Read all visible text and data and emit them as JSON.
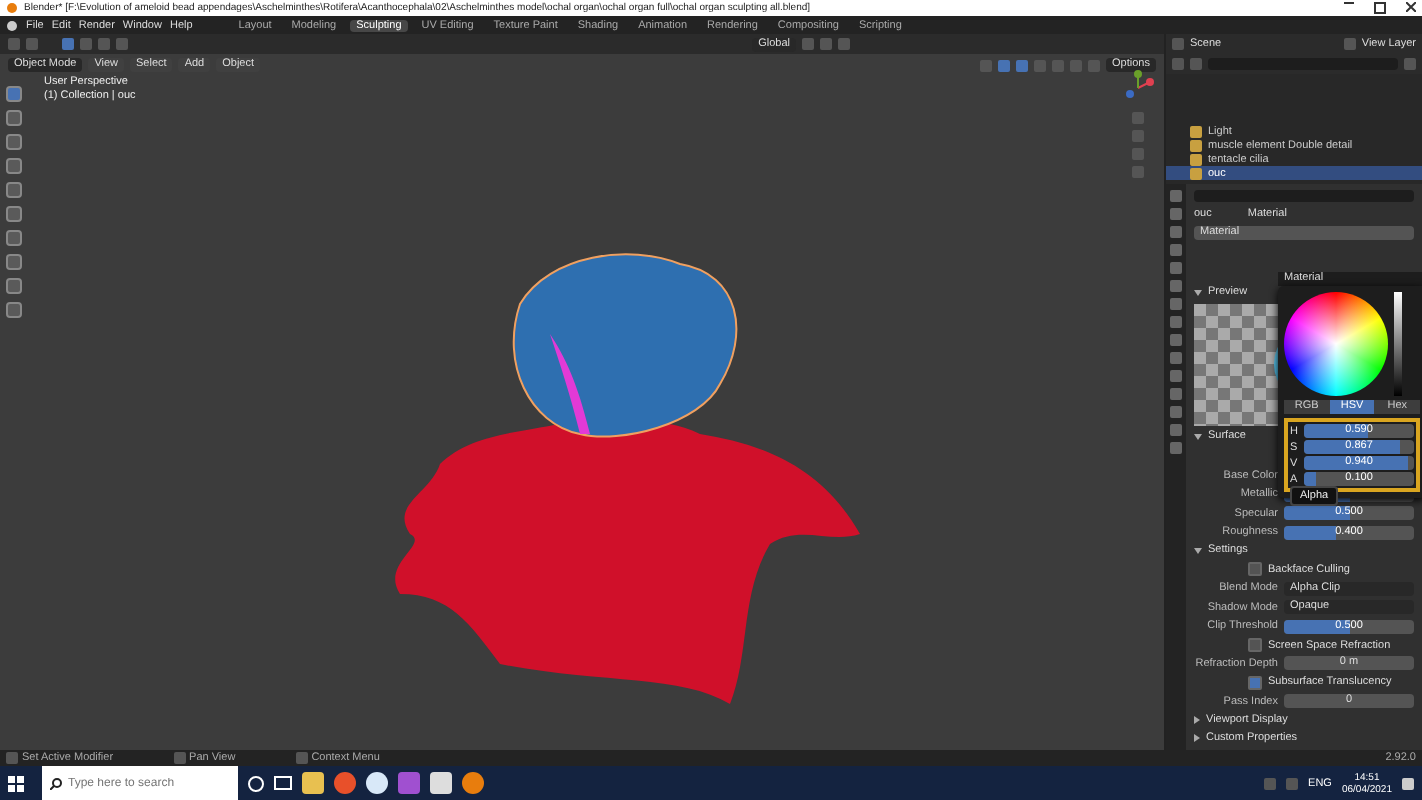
{
  "window": {
    "title": "Blender* [F:\\Evolution of ameloid bead appendages\\Aschelminthes\\Rotifera\\Acanthocephala\\02\\Aschelminthes model\\ochal organ\\ochal organ full\\ochal organ sculpting all.blend]"
  },
  "menu": [
    "File",
    "Edit",
    "Render",
    "Window",
    "Help"
  ],
  "workspaces": [
    {
      "label": "Layout",
      "selected": false
    },
    {
      "label": "Modeling",
      "selected": false
    },
    {
      "label": "Sculpting",
      "selected": true
    },
    {
      "label": "UV Editing",
      "selected": false
    },
    {
      "label": "Texture Paint",
      "selected": false
    },
    {
      "label": "Shading",
      "selected": false
    },
    {
      "label": "Animation",
      "selected": false
    },
    {
      "label": "Rendering",
      "selected": false
    },
    {
      "label": "Compositing",
      "selected": false
    },
    {
      "label": "Scripting",
      "selected": false
    }
  ],
  "scene": "Scene",
  "view_layer": "View Layer",
  "viewport": {
    "mode": "Object Mode",
    "menus": [
      "View",
      "Select",
      "Add",
      "Object"
    ],
    "transform": "Global",
    "options": "Options",
    "overlay_lines": [
      "User Perspective",
      "(1) Collection | ouc"
    ]
  },
  "outliner": {
    "items": [
      {
        "label": "Light",
        "selected": false
      },
      {
        "label": "muscle element Double detail",
        "selected": false
      },
      {
        "label": "tentacle cilia",
        "selected": false
      },
      {
        "label": "ouc",
        "selected": true
      }
    ]
  },
  "properties": {
    "object": "ouc",
    "material": "Material",
    "slot": "Material",
    "picker_title": "Material",
    "panels": [
      {
        "title": "Preview",
        "expanded": true
      },
      {
        "title": "Surface",
        "expanded": true
      }
    ],
    "surface_fields": [
      {
        "kind": "color",
        "label": "Base Color"
      },
      {
        "kind": "slider",
        "label": "Metallic",
        "level": 0.5
      },
      {
        "kind": "slider",
        "label": "Specular",
        "value": "0.500",
        "level": 0.5
      },
      {
        "kind": "slider",
        "label": "Roughness",
        "value": "0.400",
        "level": 0.4
      }
    ],
    "settings": {
      "title": "Settings",
      "expanded": true,
      "fields": [
        {
          "kind": "checkbox",
          "label": "Backface Culling",
          "checked": false
        },
        {
          "kind": "dropdown",
          "label": "Blend Mode",
          "value": "Alpha Clip"
        },
        {
          "kind": "dropdown",
          "label": "Shadow Mode",
          "value": "Opaque"
        },
        {
          "kind": "slider",
          "label": "Clip Threshold",
          "value": "0.500",
          "level": 0.5
        },
        {
          "kind": "checkbox",
          "label": "Screen Space Refraction",
          "checked": false
        },
        {
          "kind": "number",
          "label": "Refraction Depth",
          "value": "0 m"
        },
        {
          "kind": "checkbox",
          "label": "Subsurface Translucency",
          "checked": true
        },
        {
          "kind": "number",
          "label": "Pass Index",
          "value": "0"
        }
      ]
    },
    "collapsed_panels": [
      {
        "title": "Viewport Display",
        "expanded": false
      },
      {
        "title": "Custom Properties",
        "expanded": false
      }
    ]
  },
  "color_picker": {
    "tabs": [
      {
        "label": "RGB",
        "selected": false
      },
      {
        "label": "HSV",
        "selected": true
      },
      {
        "label": "Hex",
        "selected": false
      }
    ],
    "channels": [
      {
        "name": "H",
        "value": "0.590",
        "level": 0.59
      },
      {
        "name": "S",
        "value": "0.867",
        "level": 0.867
      },
      {
        "name": "V",
        "value": "0.940",
        "level": 0.94
      },
      {
        "name": "A",
        "value": "0.100",
        "level": 0.1
      }
    ],
    "tooltip": "Alpha"
  },
  "status_bar": {
    "items": [
      "Set Active Modifier",
      "Pan View",
      "Context Menu"
    ],
    "version": "2.92.0"
  },
  "taskbar": {
    "search_placeholder": "Type here to search",
    "language": "ENG",
    "time": "14:51",
    "date": "06/04/2021"
  }
}
